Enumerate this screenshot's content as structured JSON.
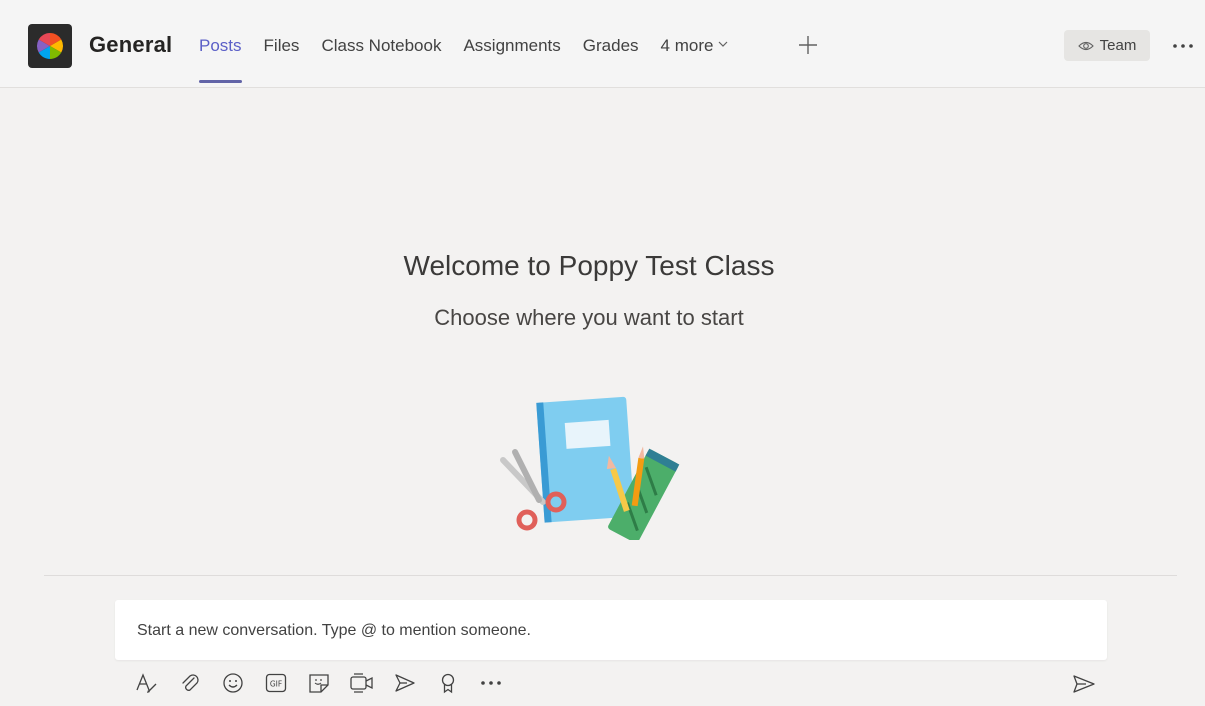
{
  "header": {
    "channel_name": "General",
    "tabs": [
      {
        "label": "Posts",
        "active": true
      },
      {
        "label": "Files"
      },
      {
        "label": "Class Notebook"
      },
      {
        "label": "Assignments"
      },
      {
        "label": "Grades"
      }
    ],
    "more_tabs_label": "4 more",
    "team_button_label": "Team",
    "accent_color": "#6264a7"
  },
  "welcome": {
    "title": "Welcome to Poppy Test Class",
    "subtitle": "Choose where you want to start"
  },
  "compose": {
    "placeholder": "Start a new conversation. Type @ to mention someone.",
    "toolbar_icons": [
      "format-icon",
      "attach-icon",
      "emoji-icon",
      "gif-icon",
      "sticker-icon",
      "meet-now-icon",
      "stream-icon",
      "praise-icon",
      "more-options-icon"
    ],
    "send_icon": "send-icon"
  }
}
